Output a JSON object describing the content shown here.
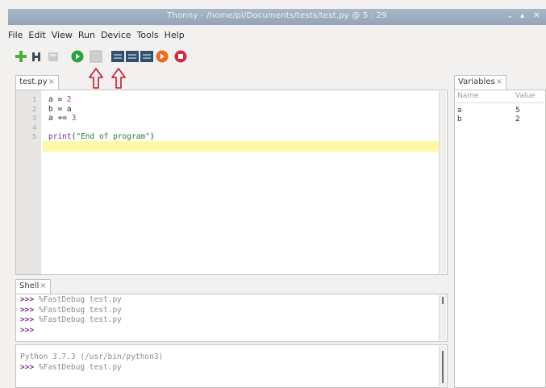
{
  "window": {
    "title": "Thonny - /home/pi/Documents/tests/test.py @ 5 : 29",
    "buttons": [
      "⌄",
      "▴",
      "✕"
    ]
  },
  "menu": [
    "File",
    "Edit",
    "View",
    "Run",
    "Device",
    "Tools",
    "Help"
  ],
  "toolbar": {
    "icons": [
      "new-file-icon",
      "open-file-icon",
      "save-icon",
      "run-icon",
      "debug-icon",
      "step-over-icon",
      "step-into-icon",
      "step-out-icon",
      "resume-icon",
      "stop-icon"
    ],
    "colors": {
      "new": "#4caf3c",
      "run": "#27a33b",
      "resume": "#ef6a21",
      "stop": "#d42a3f",
      "step": "#2f4f6a"
    }
  },
  "editor": {
    "tab_label": "test.py",
    "tab_close": "×",
    "lines": [
      {
        "n": "1",
        "parts": [
          [
            "",
            "a = "
          ],
          [
            "num",
            "2"
          ]
        ]
      },
      {
        "n": "2",
        "parts": [
          [
            "",
            "b = a"
          ]
        ]
      },
      {
        "n": "3",
        "parts": [
          [
            "",
            "a += "
          ],
          [
            "num",
            "3"
          ]
        ]
      },
      {
        "n": "4",
        "parts": []
      },
      {
        "n": "5",
        "parts": [
          [
            "kw",
            "print"
          ],
          [
            "",
            "("
          ],
          [
            "str",
            "\"End of program\""
          ],
          [
            "",
            ")"
          ]
        ]
      }
    ],
    "highlight_line": 5
  },
  "shell": {
    "tab_label": "Shell",
    "tab_close": "×",
    "prompt": ">>>",
    "top_lines": [
      {
        "prompt": true,
        "text": " %FastDebug test.py"
      },
      {
        "prompt": true,
        "text": " %FastDebug test.py"
      },
      {
        "prompt": true,
        "text": " %FastDebug test.py"
      },
      {
        "prompt": true,
        "text": ""
      }
    ],
    "bottom_lines": [
      {
        "prompt": false,
        "text": "Python 3.7.3 (/usr/bin/python3)"
      },
      {
        "prompt": true,
        "text": " %FastDebug test.py"
      }
    ]
  },
  "variables": {
    "tab_label": "Variables",
    "tab_close": "×",
    "headers": [
      "Name",
      "Value"
    ],
    "rows": [
      {
        "name": "a",
        "value": "5"
      },
      {
        "name": "b",
        "value": "2"
      }
    ]
  },
  "annotation_color": "#c8182a"
}
